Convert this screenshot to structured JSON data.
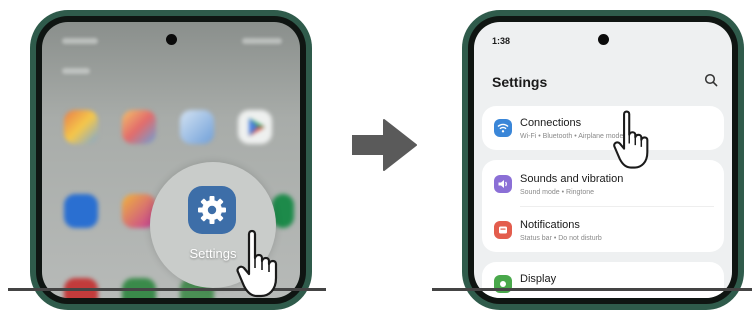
{
  "left_screen": {
    "settings_label": "Settings",
    "apps": [
      {
        "name": "gallery-app-icon",
        "color": "#e2a34f"
      },
      {
        "name": "photos-app-icon",
        "color": "#d8a06a"
      },
      {
        "name": "calendar-app-icon",
        "color": "#7fa8d6"
      },
      {
        "name": "play-store-app-icon",
        "color": "#3b9c5d"
      },
      {
        "name": "meet-app-icon",
        "color": "#2a6fd1"
      },
      {
        "name": "camera-app-icon",
        "color": "#c43a9a"
      },
      {
        "name": "spotify-app-icon",
        "color": "#1d8a4a"
      }
    ]
  },
  "right_screen": {
    "time": "1:38",
    "title": "Settings",
    "items": [
      {
        "title": "Connections",
        "subtitle": "Wi-Fi • Bluetooth • Airplane mode",
        "icon": "wifi-icon",
        "color": "#3a86d8"
      },
      {
        "title": "Sounds and vibration",
        "subtitle": "Sound mode • Ringtone",
        "icon": "speaker-icon",
        "color": "#8b6fd6"
      },
      {
        "title": "Notifications",
        "subtitle": "Status bar • Do not disturb",
        "icon": "bell-icon",
        "color": "#e35d4d"
      },
      {
        "title": "Display",
        "subtitle": "",
        "icon": "sun-icon",
        "color": "#49a84b"
      }
    ]
  },
  "colors": {
    "phone_frame": "#2f5b4b",
    "arrow": "#5a5a5a",
    "settings_icon": "#3d6ea8"
  }
}
